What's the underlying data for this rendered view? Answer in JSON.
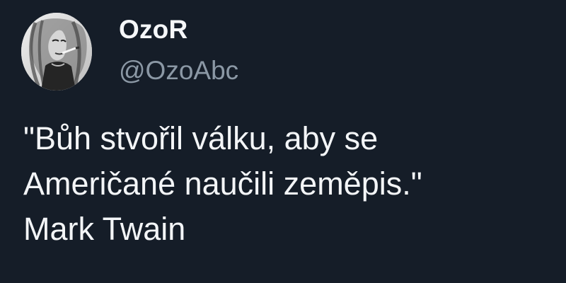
{
  "tweet": {
    "author": {
      "display_name": "OzoR",
      "handle": "@OzoAbc"
    },
    "text_lines": [
      "\"Bůh stvořil válku, aby se",
      "Američané naučili zeměpis.\"",
      "Mark Twain"
    ]
  },
  "colors": {
    "background": "#151d28",
    "primary_text": "#f3f5f7",
    "secondary_text": "#8b98a5"
  },
  "icons": {
    "avatar": "profile-photo-avatar"
  }
}
